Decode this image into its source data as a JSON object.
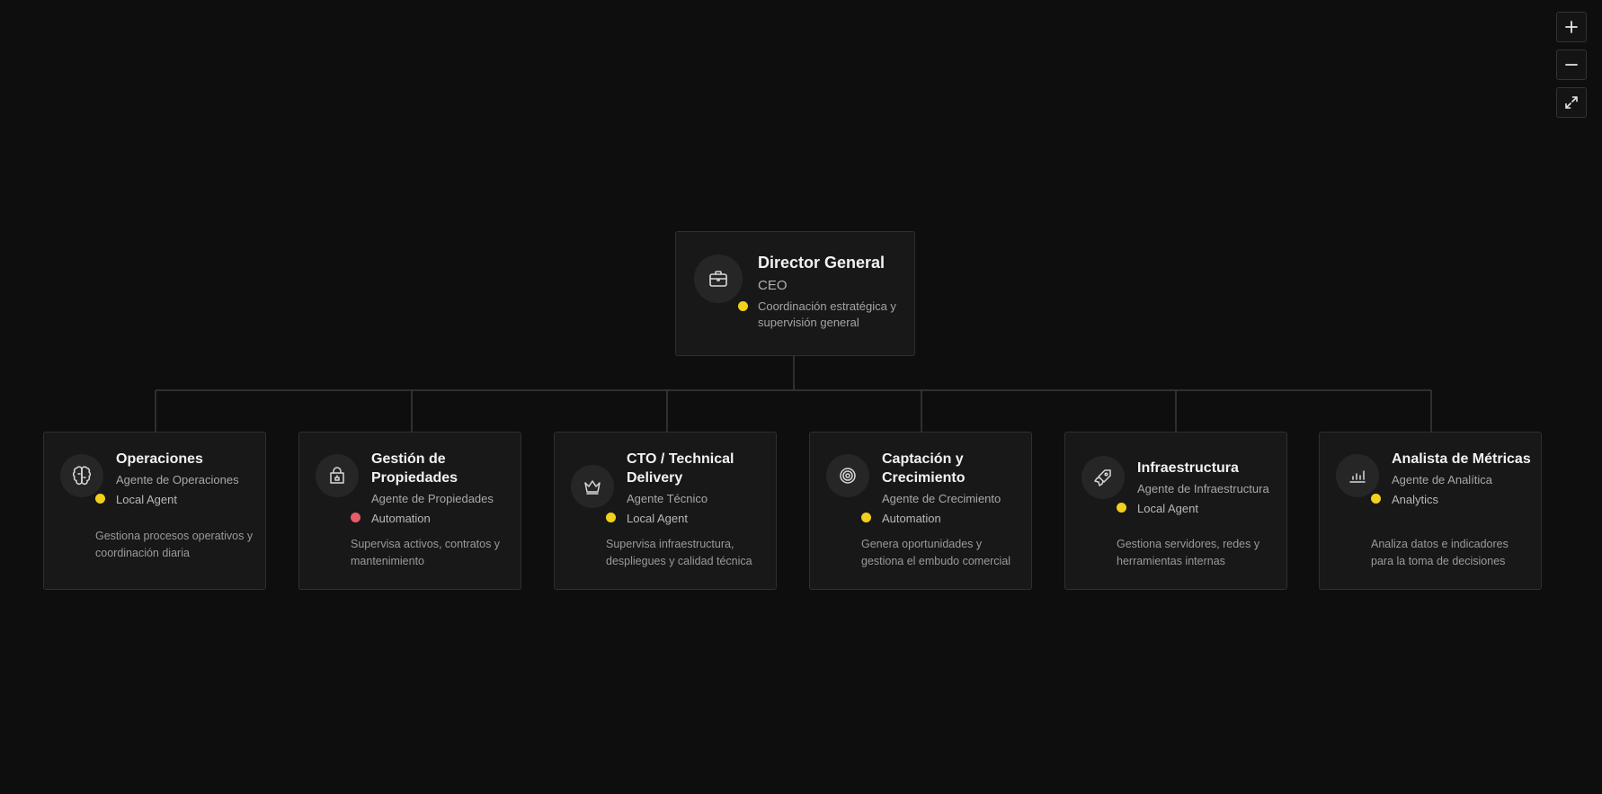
{
  "controls": {
    "zoom_in_icon": "plus-icon",
    "zoom_out_icon": "minus-icon",
    "fit_icon": "expand-icon"
  },
  "colors": {
    "background": "#0e0e0e",
    "status_yellow": "#f2d01c",
    "status_red": "#e85d6a"
  },
  "root": {
    "name": "Director General",
    "role": "CEO",
    "description": "Coordinación estratégica y supervisión general",
    "status_color": "yellow",
    "icon": "briefcase-icon"
  },
  "children": [
    {
      "name": "Operaciones",
      "role": "Agente de Operaciones",
      "status": "Local Agent",
      "status_color": "yellow",
      "description": "Gestiona procesos operativos y coordinación diaria",
      "icon": "brain-icon"
    },
    {
      "name": "Gestión de Propiedades",
      "role": "Agente de Propiedades",
      "status": "Automation",
      "status_color": "red",
      "description": "Supervisa activos, contratos y mantenimiento",
      "icon": "store-icon"
    },
    {
      "name": "CTO / Technical Delivery",
      "role": "Agente Técnico",
      "status": "Local Agent",
      "status_color": "yellow",
      "description": "Supervisa infraestructura, despliegues y calidad técnica",
      "icon": "crown-icon"
    },
    {
      "name": "Captación y Crecimiento",
      "role": "Agente de Crecimiento",
      "status": "Automation",
      "status_color": "yellow",
      "description": "Genera oportunidades y gestiona el embudo comercial",
      "icon": "target-icon"
    },
    {
      "name": "Infraestructura",
      "role": "Agente de Infraestructura",
      "status": "Local Agent",
      "status_color": "yellow",
      "description": "Gestiona servidores, redes y herramientas internas",
      "icon": "rocket-icon"
    },
    {
      "name": "Analista de Métricas",
      "role": "Agente de Analítica",
      "status": "Analytics",
      "status_color": "yellow",
      "description": "Analiza datos e indicadores para la toma de decisiones",
      "icon": "bar-chart-icon"
    }
  ]
}
